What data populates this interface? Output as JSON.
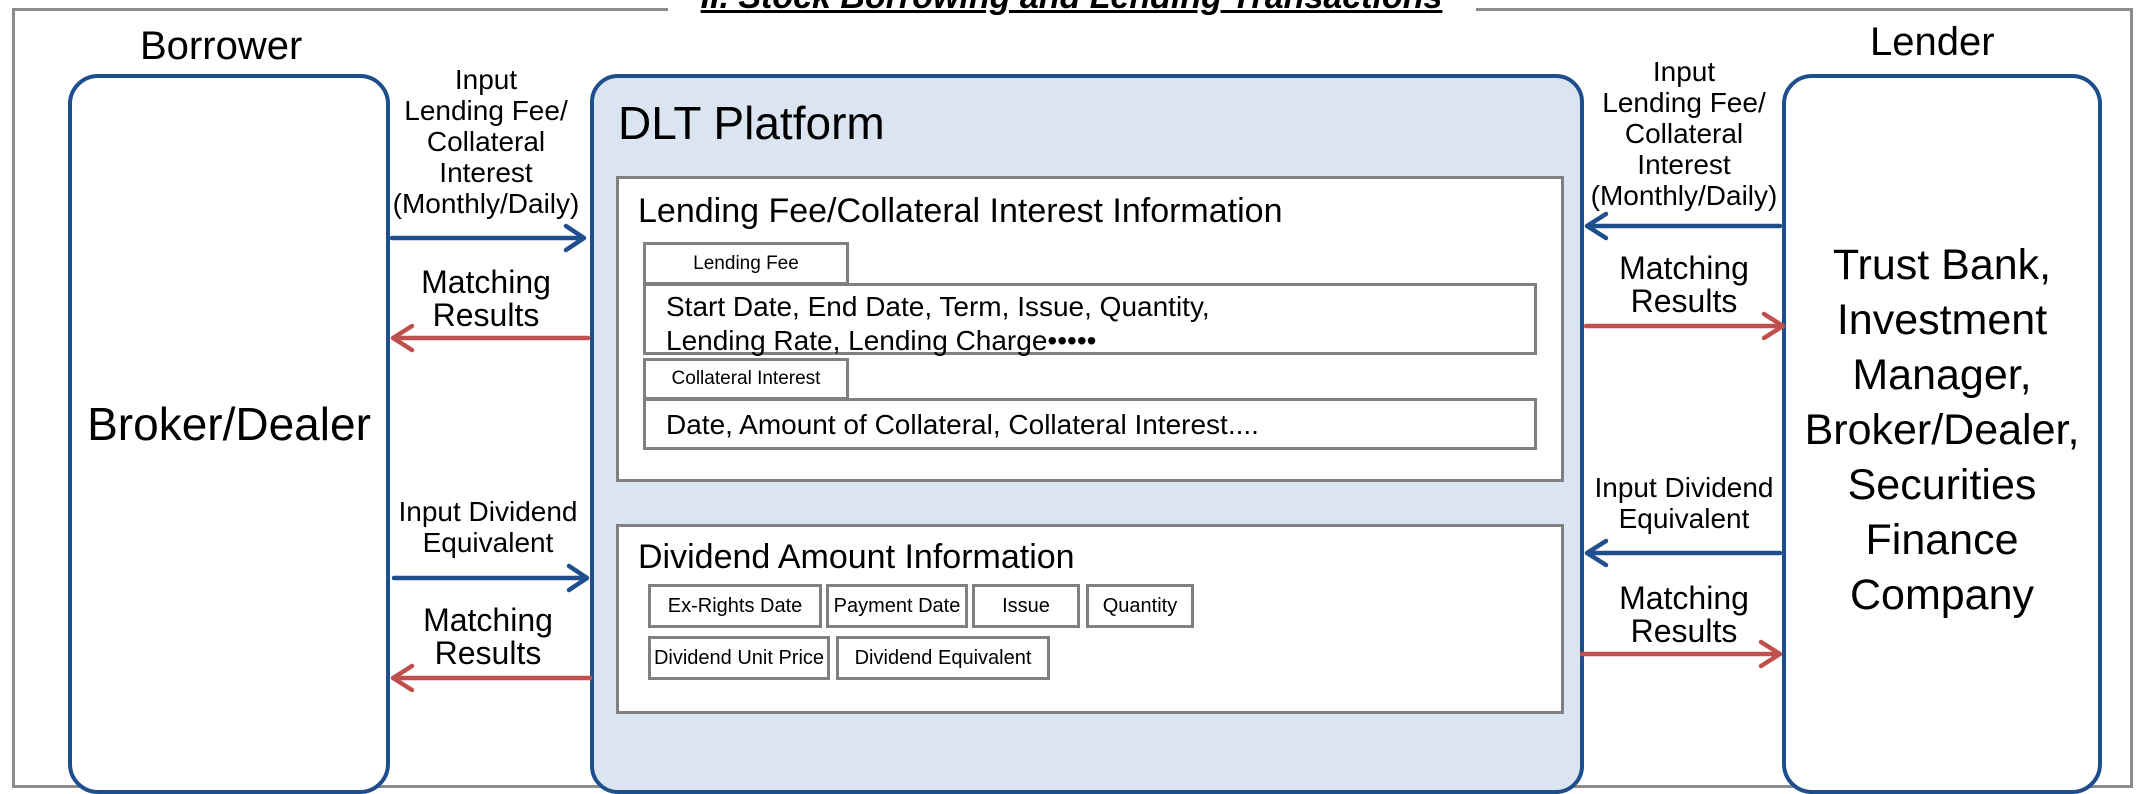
{
  "title": "II. Stock Borrowing and Lending Transactions",
  "borrower": {
    "heading": "Borrower",
    "name": "Broker/Dealer"
  },
  "lender": {
    "heading": "Lender",
    "name": "Trust Bank,\nInvestment\nManager,\nBroker/Dealer,\nSecurities\nFinance\nCompany"
  },
  "platform": {
    "title": "DLT Platform",
    "lending_panel": {
      "title": "Lending Fee/Collateral Interest Information",
      "lending_fee_tab": "Lending Fee",
      "lending_fee_fields": "Start Date, End Date, Term, Issue, Quantity,\nLending Rate, Lending Charge•••••",
      "collateral_tab": "Collateral Interest",
      "collateral_fields": "Date, Amount of Collateral, Collateral Interest...."
    },
    "dividend_panel": {
      "title": "Dividend Amount Information",
      "fields": [
        "Ex-Rights Date",
        "Payment Date",
        "Issue",
        "Quantity",
        "Dividend Unit Price",
        "Dividend Equivalent"
      ]
    }
  },
  "flows": {
    "left_input_fee": "Input\nLending Fee/\nCollateral\nInterest\n(Monthly/Daily)",
    "left_matching_1": "Matching\nResults",
    "left_input_dividend": "Input Dividend\nEquivalent",
    "left_matching_2": "Matching\nResults",
    "right_input_fee": "Input\nLending Fee/\nCollateral\nInterest\n(Monthly/Daily)",
    "right_matching_1": "Matching\nResults",
    "right_input_dividend": "Input Dividend\nEquivalent",
    "right_matching_2": "Matching\nResults"
  },
  "colors": {
    "input_arrow": "#1f4e8c",
    "matching_arrow": "#c0504d",
    "platform_fill": "#dbe5f1",
    "border": "#1f4e8c"
  }
}
